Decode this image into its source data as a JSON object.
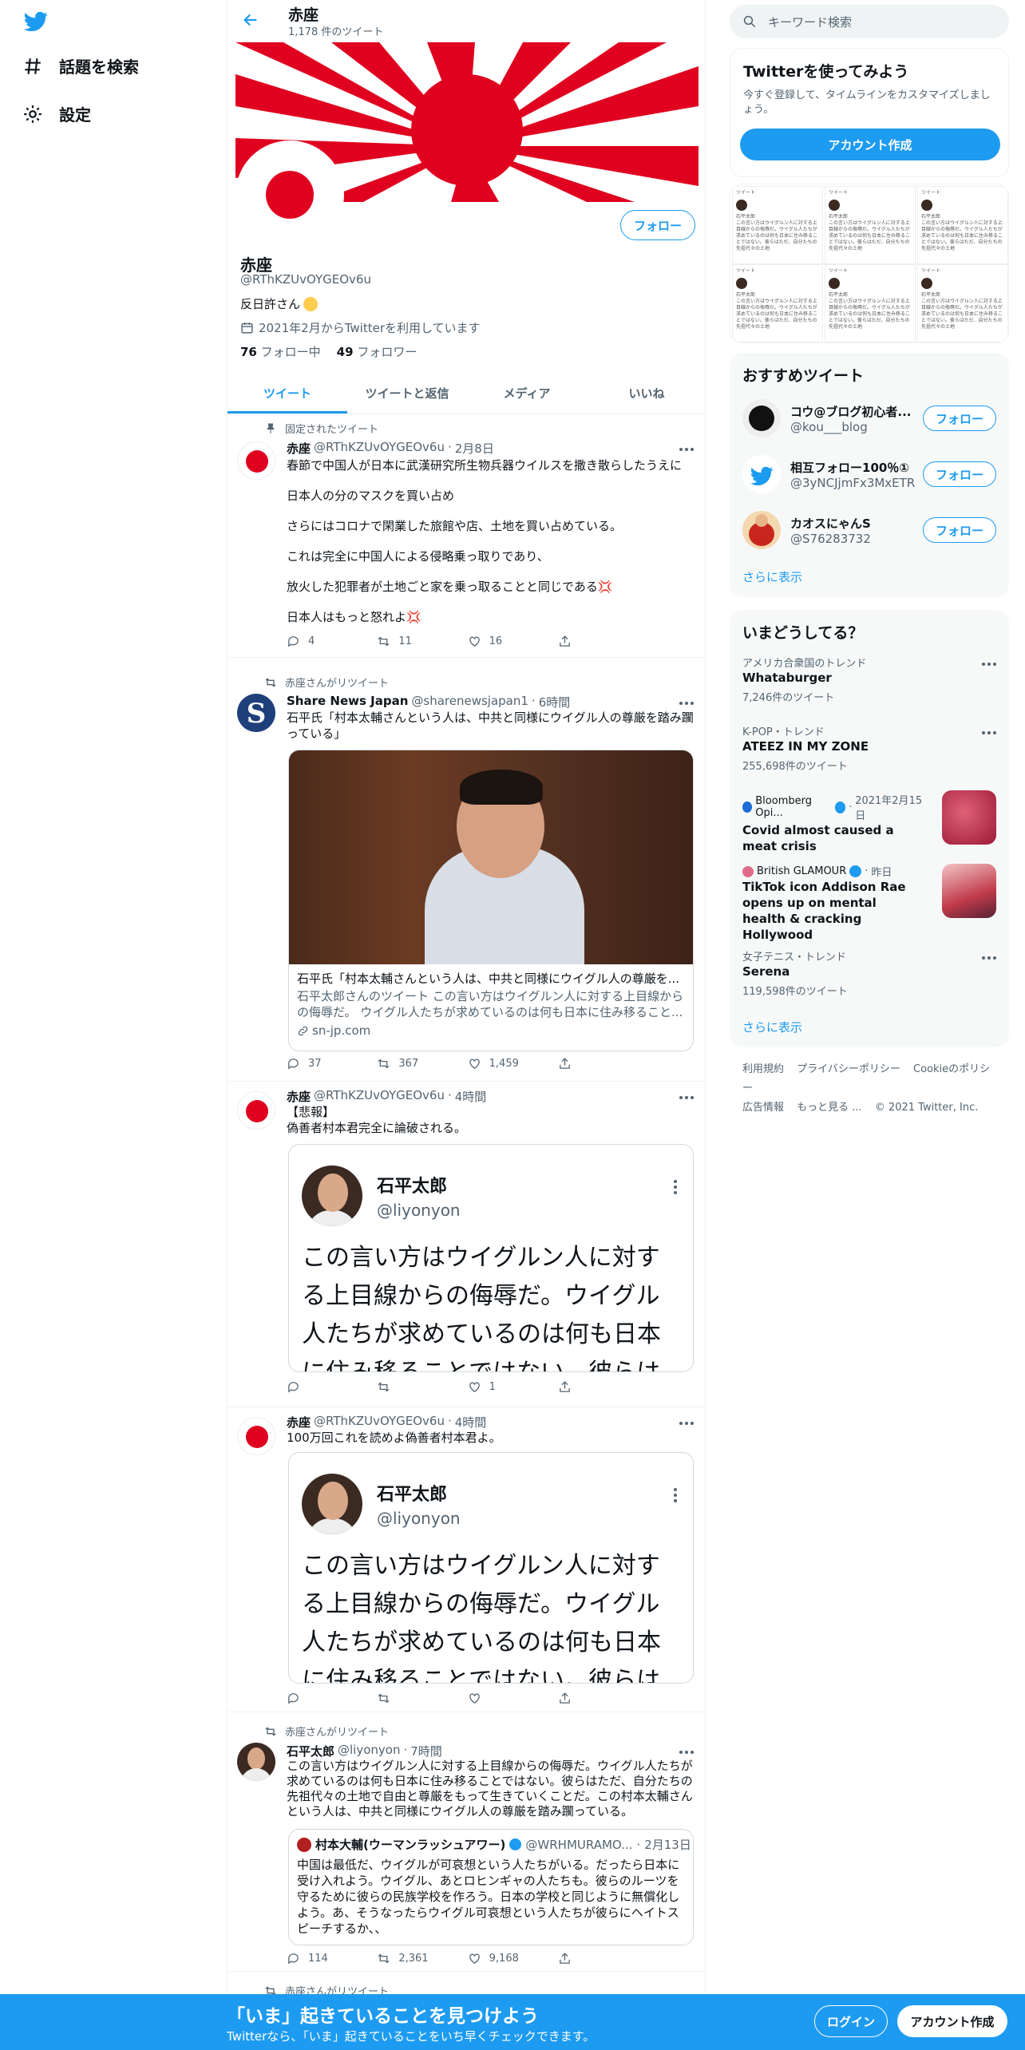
{
  "nav": {
    "explore": "話題を検索",
    "settings": "設定"
  },
  "header": {
    "title": "赤座",
    "tweet_count": "1,178 件のツイート"
  },
  "profile": {
    "name": "赤座",
    "handle": "@RThKZUvOYGEOv6u",
    "bio": "反日許さん",
    "joined": "2021年2月からTwitterを利用しています",
    "following_count": "76",
    "following_label": "フォロー中",
    "followers_count": "49",
    "followers_label": "フォロワー",
    "follow_button": "フォロー"
  },
  "tabs": [
    "ツイート",
    "ツイートと返信",
    "メディア",
    "いいね"
  ],
  "tweets": [
    {
      "context": "固定されたツイート",
      "name": "赤座",
      "handle": "@RThKZUvOYGEOv6u",
      "time": "2月8日",
      "lines": [
        "春節で中国人が日本に武漢研究所生物兵器ウイルスを撒き散らしたうえに",
        "日本人の分のマスクを買い占め",
        "さらにはコロナで閑業した旅館や店、土地を買い占めている。",
        "これは完全に中国人による侵略乗っ取りであり、",
        "放火した犯罪者が土地ごと家を乗っ取ることと同じである💢",
        "日本人はもっと怒れよ💢"
      ],
      "replies": "4",
      "retweets": "11",
      "likes": "16"
    },
    {
      "context": "赤座さんがリツイート",
      "name": "Share News Japan",
      "handle": "@sharenewsjapan1",
      "time": "6時間",
      "text": "石平氏「村本太輔さんという人は、中共と同様にウイグル人の尊厳を踏み躙っている」",
      "card_title": "石平氏「村本太輔さんという人は、中共と同様にウイグル人の尊厳を...",
      "card_desc": "石平太郎さんのツイート この言い方はウイグルン人に対する上目線からの侮辱だ。 ウイグル人たちが求めているのは何も日本に住み移ること...",
      "card_domain": "sn-jp.com",
      "replies": "37",
      "retweets": "367",
      "likes": "1,459"
    },
    {
      "name": "赤座",
      "handle": "@RThKZUvOYGEOv6u",
      "time": "4時間",
      "text_line1": "【悲報】",
      "text_line2": "偽善者村本君完全に論破される。",
      "embed_name": "石平太郎",
      "embed_handle": "@liyonyon",
      "embed_text": "この言い方はウイグルン人に対する上目線からの侮辱だ。ウイグル人たちが求めているのは何も日本に住み移ることではない。彼らは",
      "replies": "",
      "retweets": "",
      "likes": "1"
    },
    {
      "name": "赤座",
      "handle": "@RThKZUvOYGEOv6u",
      "time": "4時間",
      "text": "100万回これを読めよ偽善者村本君よ。",
      "embed_name": "石平太郎",
      "embed_handle": "@liyonyon",
      "embed_text": "この言い方はウイグルン人に対する上目線からの侮辱だ。ウイグル人たちが求めているのは何も日本に住み移ることではない。彼らは"
    },
    {
      "context": "赤座さんがリツイート",
      "name": "石平太郎",
      "handle": "@liyonyon",
      "time": "7時間",
      "text": "この言い方はウイグルン人に対する上目線からの侮辱だ。ウイグル人たちが求めているのは何も日本に住み移ることではない。彼らはただ、自分たちの先祖代々の土地で自由と尊厳をもって生きていくことだ。この村本太輔さんという人は、中共と同様にウイグル人の尊厳を踏み躙っている。",
      "quote_name": "村本大輔(ウーマンラッシュアワー)",
      "quote_handle": "@WRHMURAMO...",
      "quote_time": "2月13日",
      "quote_text": "中国は最低だ、ウイグルが可哀想という人たちがいる。だったら日本に受け入れよう。ウイグル、あとロヒンギャの人たちも。彼らのルーツを守るために彼らの民族学校を作ろう。日本の学校と同じように無償化しよう。あ、そうなったらウイグル可哀想という人たちが彼らにヘイトスピーチするか、、",
      "replies": "114",
      "retweets": "2,361",
      "likes": "9,168"
    },
    {
      "context": "赤座さんがリツイート"
    }
  ],
  "right": {
    "search_placeholder": "キーワード検索",
    "signup_title": "Twitterを使ってみよう",
    "signup_desc": "今すぐ登録して、タイムラインをカスタマイズしましょう。",
    "signup_button": "アカウント作成",
    "recommended_title": "おすすめツイート",
    "recommended": [
      {
        "name": "コウ@ブログ初心者...",
        "handle": "@kou___blog",
        "button": "フォロー"
      },
      {
        "name": "相互フォロー100％①",
        "handle": "@3yNCJjmFx3MxETR",
        "button": "フォロー"
      },
      {
        "name": "カオスにゃんS",
        "handle": "@S76283732",
        "button": "フォロー"
      }
    ],
    "show_more": "さらに表示",
    "trends_title": "いまどうしてる？",
    "trends": [
      {
        "meta": "アメリカ合衆国のトレンド",
        "name": "Whataburger",
        "count": "7,246件のツイート"
      },
      {
        "meta": "K-POP・トレンド",
        "name": "ATEEZ IN MY ZONE",
        "count": "255,698件のツイート"
      },
      {
        "meta_source": "Bloomberg Opi...",
        "meta_time": "2021年2月15日",
        "name": "Covid almost caused a meat crisis"
      },
      {
        "meta_source": "British GLAMOUR",
        "meta_time": "昨日",
        "name": "TikTok icon Addison Rae opens up on mental health & cracking Hollywood"
      },
      {
        "meta": "女子テニス・トレンド",
        "name": "Serena",
        "count": "119,598件のツイート"
      }
    ],
    "show_more_2": "さらに表示",
    "footer": [
      "利用規約",
      "プライバシーポリシー",
      "Cookieのポリシー",
      "広告情報",
      "もっと見る ...",
      "© 2021 Twitter, Inc."
    ],
    "mosaic_label": "ツイート",
    "mosaic_name": "石平太郎",
    "mosaic_text": "この言い方はウイグルン人に対する上目線からの侮辱だ。ウイグル人たちが求めているのは何も日本に住み移ることではない。彼らはただ、自分たちの先祖代々の土地"
  },
  "bottombar": {
    "title": "「いま」起きていることを見つけよう",
    "subtitle": "Twitterなら、「いま」起きていることをいち早くチェックできます。",
    "login": "ログイン",
    "signup": "アカウント作成"
  },
  "colors": {
    "accent": "#1d9bf0",
    "flag_red": "#e0001f"
  }
}
